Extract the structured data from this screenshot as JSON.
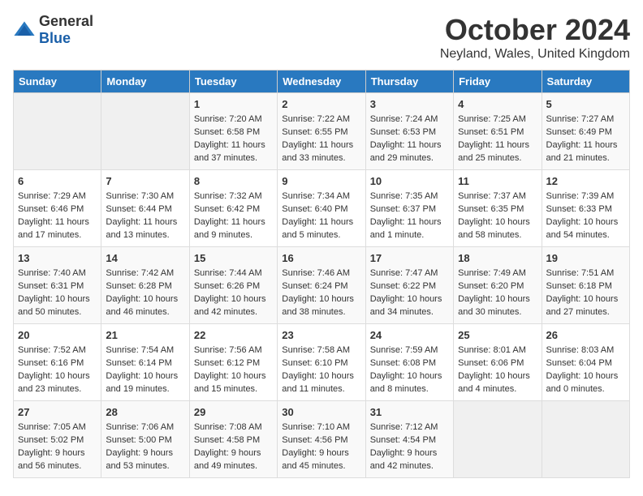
{
  "header": {
    "logo_general": "General",
    "logo_blue": "Blue",
    "title": "October 2024",
    "location": "Neyland, Wales, United Kingdom"
  },
  "days_of_week": [
    "Sunday",
    "Monday",
    "Tuesday",
    "Wednesday",
    "Thursday",
    "Friday",
    "Saturday"
  ],
  "weeks": [
    [
      {
        "day": "",
        "empty": true
      },
      {
        "day": "",
        "empty": true
      },
      {
        "day": "1",
        "sunrise": "7:20 AM",
        "sunset": "6:58 PM",
        "daylight": "11 hours and 37 minutes."
      },
      {
        "day": "2",
        "sunrise": "7:22 AM",
        "sunset": "6:55 PM",
        "daylight": "11 hours and 33 minutes."
      },
      {
        "day": "3",
        "sunrise": "7:24 AM",
        "sunset": "6:53 PM",
        "daylight": "11 hours and 29 minutes."
      },
      {
        "day": "4",
        "sunrise": "7:25 AM",
        "sunset": "6:51 PM",
        "daylight": "11 hours and 25 minutes."
      },
      {
        "day": "5",
        "sunrise": "7:27 AM",
        "sunset": "6:49 PM",
        "daylight": "11 hours and 21 minutes."
      }
    ],
    [
      {
        "day": "6",
        "sunrise": "7:29 AM",
        "sunset": "6:46 PM",
        "daylight": "11 hours and 17 minutes."
      },
      {
        "day": "7",
        "sunrise": "7:30 AM",
        "sunset": "6:44 PM",
        "daylight": "11 hours and 13 minutes."
      },
      {
        "day": "8",
        "sunrise": "7:32 AM",
        "sunset": "6:42 PM",
        "daylight": "11 hours and 9 minutes."
      },
      {
        "day": "9",
        "sunrise": "7:34 AM",
        "sunset": "6:40 PM",
        "daylight": "11 hours and 5 minutes."
      },
      {
        "day": "10",
        "sunrise": "7:35 AM",
        "sunset": "6:37 PM",
        "daylight": "11 hours and 1 minute."
      },
      {
        "day": "11",
        "sunrise": "7:37 AM",
        "sunset": "6:35 PM",
        "daylight": "10 hours and 58 minutes."
      },
      {
        "day": "12",
        "sunrise": "7:39 AM",
        "sunset": "6:33 PM",
        "daylight": "10 hours and 54 minutes."
      }
    ],
    [
      {
        "day": "13",
        "sunrise": "7:40 AM",
        "sunset": "6:31 PM",
        "daylight": "10 hours and 50 minutes."
      },
      {
        "day": "14",
        "sunrise": "7:42 AM",
        "sunset": "6:28 PM",
        "daylight": "10 hours and 46 minutes."
      },
      {
        "day": "15",
        "sunrise": "7:44 AM",
        "sunset": "6:26 PM",
        "daylight": "10 hours and 42 minutes."
      },
      {
        "day": "16",
        "sunrise": "7:46 AM",
        "sunset": "6:24 PM",
        "daylight": "10 hours and 38 minutes."
      },
      {
        "day": "17",
        "sunrise": "7:47 AM",
        "sunset": "6:22 PM",
        "daylight": "10 hours and 34 minutes."
      },
      {
        "day": "18",
        "sunrise": "7:49 AM",
        "sunset": "6:20 PM",
        "daylight": "10 hours and 30 minutes."
      },
      {
        "day": "19",
        "sunrise": "7:51 AM",
        "sunset": "6:18 PM",
        "daylight": "10 hours and 27 minutes."
      }
    ],
    [
      {
        "day": "20",
        "sunrise": "7:52 AM",
        "sunset": "6:16 PM",
        "daylight": "10 hours and 23 minutes."
      },
      {
        "day": "21",
        "sunrise": "7:54 AM",
        "sunset": "6:14 PM",
        "daylight": "10 hours and 19 minutes."
      },
      {
        "day": "22",
        "sunrise": "7:56 AM",
        "sunset": "6:12 PM",
        "daylight": "10 hours and 15 minutes."
      },
      {
        "day": "23",
        "sunrise": "7:58 AM",
        "sunset": "6:10 PM",
        "daylight": "10 hours and 11 minutes."
      },
      {
        "day": "24",
        "sunrise": "7:59 AM",
        "sunset": "6:08 PM",
        "daylight": "10 hours and 8 minutes."
      },
      {
        "day": "25",
        "sunrise": "8:01 AM",
        "sunset": "6:06 PM",
        "daylight": "10 hours and 4 minutes."
      },
      {
        "day": "26",
        "sunrise": "8:03 AM",
        "sunset": "6:04 PM",
        "daylight": "10 hours and 0 minutes."
      }
    ],
    [
      {
        "day": "27",
        "sunrise": "7:05 AM",
        "sunset": "5:02 PM",
        "daylight": "9 hours and 56 minutes."
      },
      {
        "day": "28",
        "sunrise": "7:06 AM",
        "sunset": "5:00 PM",
        "daylight": "9 hours and 53 minutes."
      },
      {
        "day": "29",
        "sunrise": "7:08 AM",
        "sunset": "4:58 PM",
        "daylight": "9 hours and 49 minutes."
      },
      {
        "day": "30",
        "sunrise": "7:10 AM",
        "sunset": "4:56 PM",
        "daylight": "9 hours and 45 minutes."
      },
      {
        "day": "31",
        "sunrise": "7:12 AM",
        "sunset": "4:54 PM",
        "daylight": "9 hours and 42 minutes."
      },
      {
        "day": "",
        "empty": true
      },
      {
        "day": "",
        "empty": true
      }
    ]
  ],
  "labels": {
    "sunrise": "Sunrise:",
    "sunset": "Sunset:",
    "daylight": "Daylight:"
  }
}
